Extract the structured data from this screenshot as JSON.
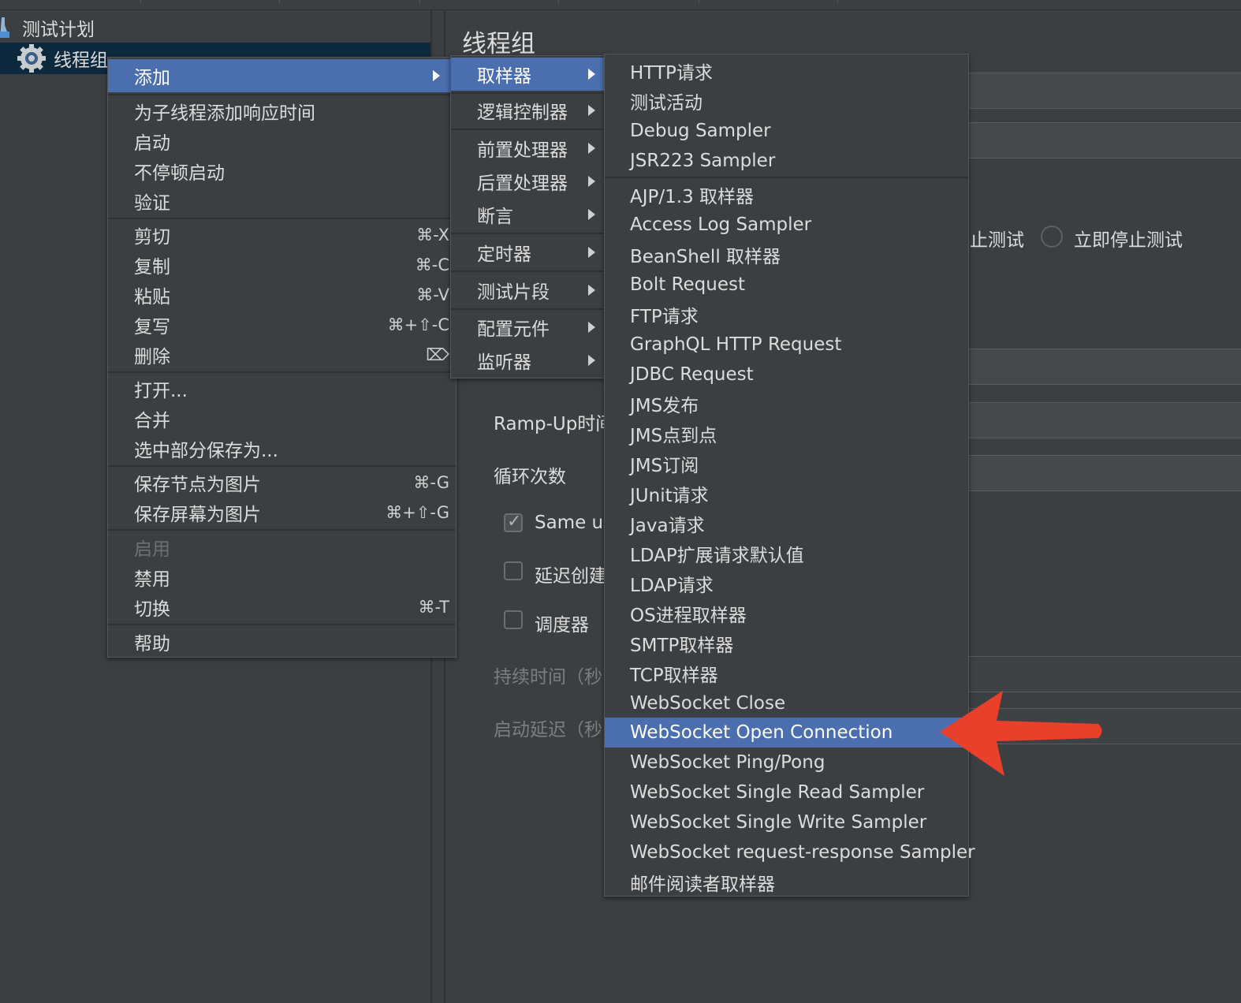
{
  "tree": {
    "items": [
      {
        "label": "测试计划"
      },
      {
        "label": "线程组"
      }
    ]
  },
  "panel": {
    "title": "线程组",
    "stop_test_partial": "止测试",
    "stop_now_label": "立即停止测试",
    "rampup_label": "Ramp-Up时间",
    "loop_label": "循环次数",
    "same_user_label": "Same us",
    "delay_create_label": "延迟创建",
    "scheduler_label": "调度器",
    "duration_label": "持续时间（秒",
    "startup_delay_label": "启动延迟（秒"
  },
  "context_menu": {
    "items": [
      {
        "label": "添加",
        "submenu": true,
        "active": true
      },
      {
        "label": "为子线程添加响应时间"
      },
      {
        "label": "启动"
      },
      {
        "label": "不停顿启动"
      },
      {
        "label": "验证"
      },
      {
        "label": "剪切",
        "shortcut": "⌘-X"
      },
      {
        "label": "复制",
        "shortcut": "⌘-C"
      },
      {
        "label": "粘贴",
        "shortcut": "⌘-V"
      },
      {
        "label": "复写",
        "shortcut": "⌘+⇧-C"
      },
      {
        "label": "删除",
        "shortcut": "⌦"
      },
      {
        "label": "打开..."
      },
      {
        "label": "合并"
      },
      {
        "label": "选中部分保存为..."
      },
      {
        "label": "保存节点为图片",
        "shortcut": "⌘-G"
      },
      {
        "label": "保存屏幕为图片",
        "shortcut": "⌘+⇧-G"
      },
      {
        "label": "启用",
        "disabled": true
      },
      {
        "label": "禁用"
      },
      {
        "label": "切换",
        "shortcut": "⌘-T"
      },
      {
        "label": "帮助"
      }
    ]
  },
  "add_menu": {
    "items": [
      {
        "label": "取样器",
        "active": true
      },
      {
        "label": "逻辑控制器"
      },
      {
        "label": "前置处理器"
      },
      {
        "label": "后置处理器"
      },
      {
        "label": "断言"
      },
      {
        "label": "定时器"
      },
      {
        "label": "测试片段"
      },
      {
        "label": "配置元件"
      },
      {
        "label": "监听器"
      }
    ]
  },
  "sampler_menu": {
    "items": [
      {
        "label": "HTTP请求"
      },
      {
        "label": "测试活动"
      },
      {
        "label": "Debug Sampler"
      },
      {
        "label": "JSR223 Sampler"
      },
      {
        "label": "AJP/1.3 取样器"
      },
      {
        "label": "Access Log Sampler"
      },
      {
        "label": "BeanShell 取样器"
      },
      {
        "label": "Bolt Request"
      },
      {
        "label": "FTP请求"
      },
      {
        "label": "GraphQL HTTP Request"
      },
      {
        "label": "JDBC Request"
      },
      {
        "label": "JMS发布"
      },
      {
        "label": "JMS点到点"
      },
      {
        "label": "JMS订阅"
      },
      {
        "label": "JUnit请求"
      },
      {
        "label": "Java请求"
      },
      {
        "label": "LDAP扩展请求默认值"
      },
      {
        "label": "LDAP请求"
      },
      {
        "label": "OS进程取样器"
      },
      {
        "label": "SMTP取样器"
      },
      {
        "label": "TCP取样器"
      },
      {
        "label": "WebSocket Close"
      },
      {
        "label": "WebSocket Open Connection",
        "active": true
      },
      {
        "label": "WebSocket Ping/Pong"
      },
      {
        "label": "WebSocket Single Read Sampler"
      },
      {
        "label": "WebSocket Single Write Sampler"
      },
      {
        "label": "WebSocket request-response Sampler"
      },
      {
        "label": "邮件阅读者取样器"
      }
    ]
  },
  "colors": {
    "background": "#3c3f41",
    "highlight": "#4b6eaf",
    "annotation_arrow": "#e8402a"
  }
}
